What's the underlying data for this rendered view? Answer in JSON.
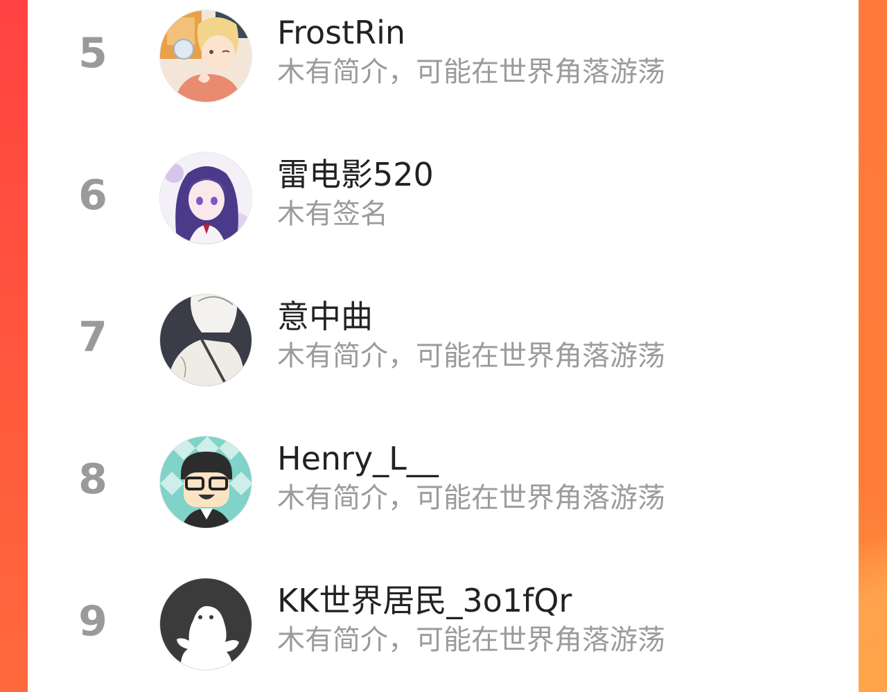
{
  "colors": {
    "background_left": "#ff4a3d",
    "background_right": "#ff7c39",
    "rank_color": "#9a9a9a",
    "name_color": "#222222",
    "bio_color": "#9b9b9b"
  },
  "ranking": [
    {
      "rank": "5",
      "name": "FrostRin",
      "bio": "木有简介，可能在世界角落游荡",
      "avatar": "anime-boy-avatar"
    },
    {
      "rank": "6",
      "name": "雷电影520",
      "bio": "木有签名",
      "avatar": "anime-girl-purple-avatar"
    },
    {
      "rank": "7",
      "name": "意中曲",
      "bio": "木有简介，可能在世界角落游荡",
      "avatar": "sketch-boy-avatar"
    },
    {
      "rank": "8",
      "name": "Henry_L__",
      "bio": "木有简介，可能在世界角落游荡",
      "avatar": "cartoon-glasses-avatar"
    },
    {
      "rank": "9",
      "name": "KK世界居民_3o1fQr",
      "bio": "木有简介，可能在世界角落游荡",
      "avatar": "default-ghost-avatar"
    }
  ]
}
